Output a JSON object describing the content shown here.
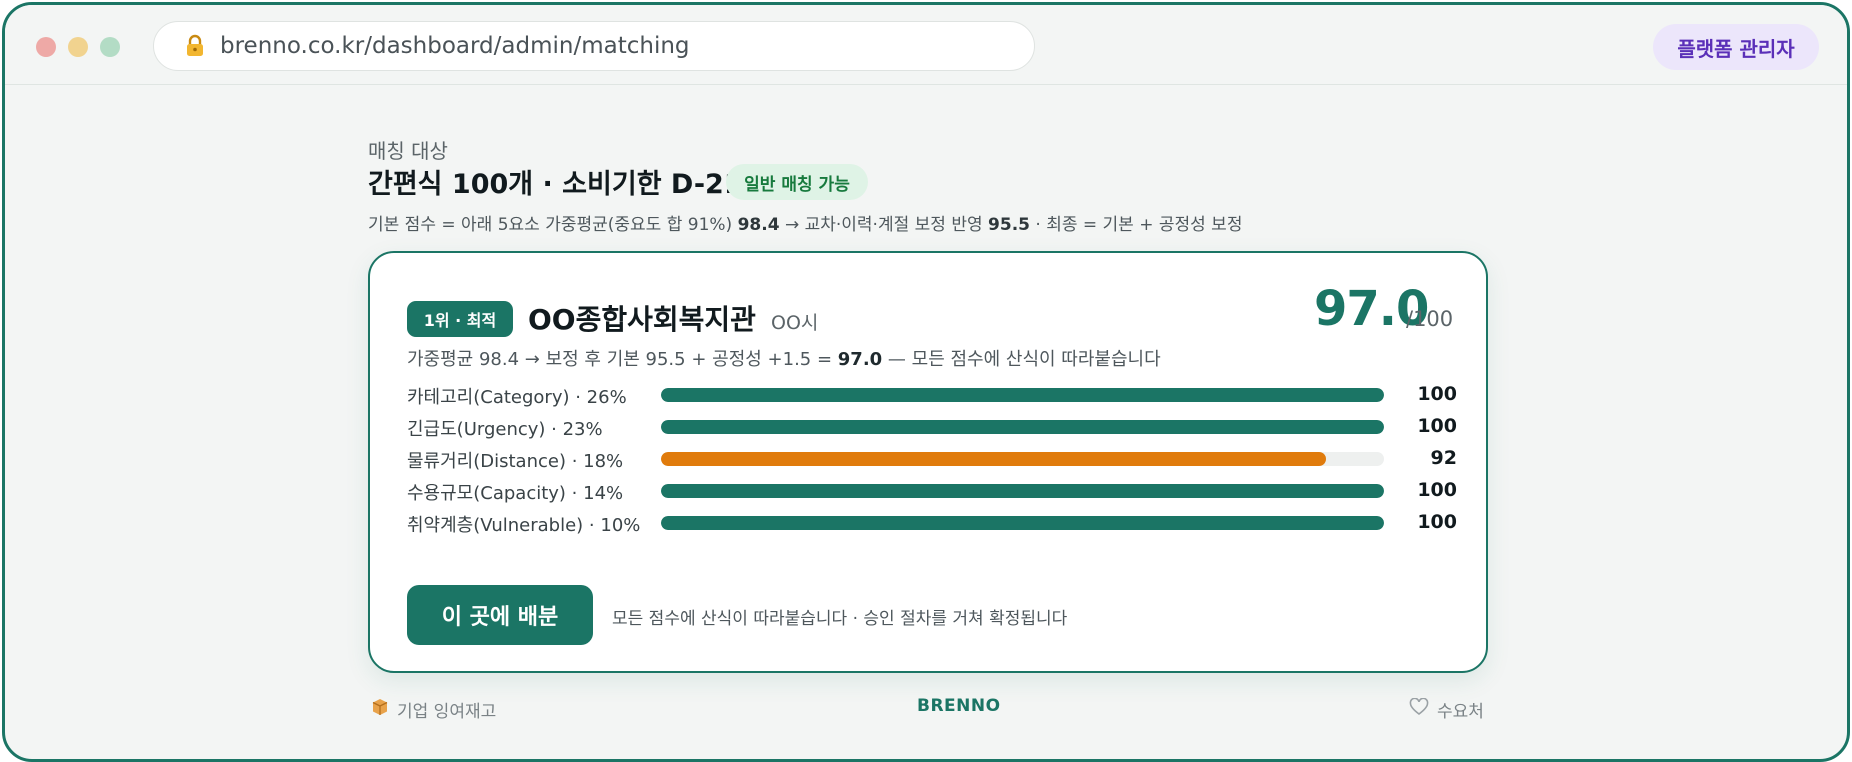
{
  "browser": {
    "url": "brenno.co.kr/dashboard/admin/matching",
    "role_badge": "플랫폼 관리자"
  },
  "header": {
    "eyebrow": "매칭 대상",
    "item_title": "간편식 100개 · 소비기한 D-21",
    "match_badge": "일반 매칭 가능",
    "formula_prefix": "기본 점수 = 아래 5요소 가중평균(중요도 합 91%) ",
    "formula_weighted": "98.4",
    "formula_mid": " → 교차·이력·계절 보정 반영 ",
    "formula_adjusted": "95.5",
    "formula_suffix": " · 최종 = 기본 + 공정성 보정"
  },
  "card": {
    "rank_badge": "1위 · 최적",
    "org_name": "OO종합사회복지관",
    "org_city": "OO시",
    "score": "97.0",
    "score_max": "/100",
    "formula_prefix": "가중평균 98.4 → 보정 후 기본 95.5 + 공정성 +1.5 = ",
    "formula_total": "97.0",
    "formula_suffix": " — 모든 점수에 산식이 따라붙습니다",
    "factors": [
      {
        "label": "카테고리(Category) · 26%",
        "value": 100,
        "display": "100",
        "color": "#1b7565"
      },
      {
        "label": "긴급도(Urgency) · 23%",
        "value": 100,
        "display": "100",
        "color": "#1b7565"
      },
      {
        "label": "물류거리(Distance) · 18%",
        "value": 92,
        "display": "92",
        "color": "#e07b0c"
      },
      {
        "label": "수용규모(Capacity) · 14%",
        "value": 100,
        "display": "100",
        "color": "#1b7565"
      },
      {
        "label": "취약계층(Vulnerable) · 10%",
        "value": 100,
        "display": "100",
        "color": "#1b7565"
      }
    ],
    "cta_label": "이 곳에 배분",
    "cta_note": "모든 점수에 산식이 따라붙습니다 · 승인 절차를 거쳐 확정됩니다"
  },
  "footer": {
    "left_label": "기업 잉여재고",
    "brand": "BRENNO",
    "right_label": "수요처"
  },
  "colors": {
    "accent": "#1b7565",
    "warning": "#e07b0c",
    "role_badge_bg": "#ece6fb",
    "match_badge_bg": "#dff3e6"
  },
  "icons": {
    "lock": "lock-icon",
    "box": "package-icon",
    "heart": "heart-icon"
  }
}
